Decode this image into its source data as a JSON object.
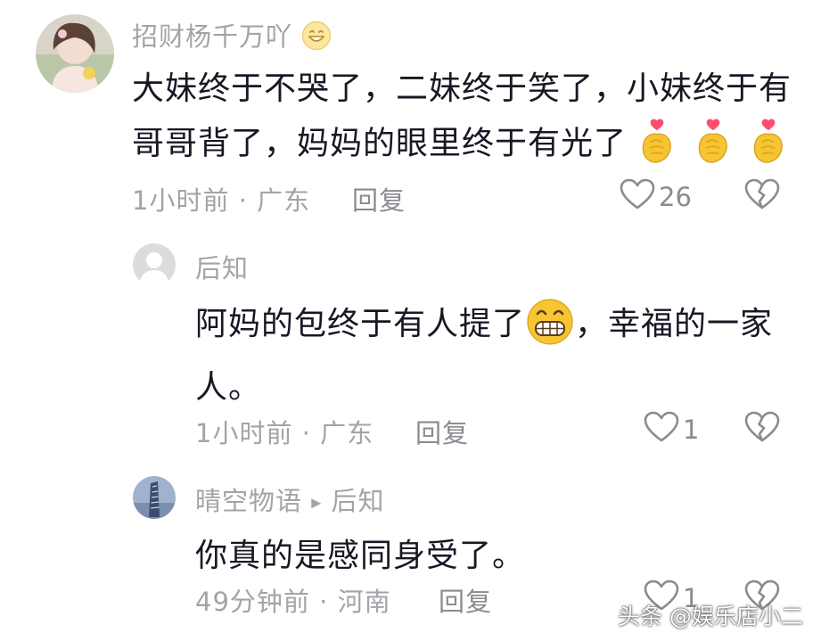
{
  "comments": [
    {
      "username": "招财杨千万吖",
      "line1": "大妹终于不哭了，二妹终于笑了，小妹终于有",
      "line2": "哥哥背了，妈妈的眼里终于有光了",
      "time": "1小时前",
      "dot": "·",
      "location": "广东",
      "reply": "回复",
      "likes": "26",
      "icons": [
        "smile-emoji",
        "finger-heart-emoji",
        "heart-outline-icon",
        "broken-heart-icon"
      ]
    },
    {
      "username": "后知",
      "line1": "阿妈的包终于有人提了",
      "line1b": "，幸福的一家",
      "line2": "人。",
      "time": "1小时前",
      "dot": "·",
      "location": "广东",
      "reply": "回复",
      "likes": "1",
      "icons": [
        "grin-emoji",
        "heart-outline-icon",
        "broken-heart-icon"
      ]
    },
    {
      "username": "晴空物语",
      "arrow": "▸",
      "reply_to": "后知",
      "line1": "你真的是感同身受了。",
      "time": "49分钟前",
      "dot": "·",
      "location": "河南",
      "reply": "回复",
      "likes": "1",
      "icons": [
        "play-arrow-icon",
        "heart-outline-icon",
        "broken-heart-icon"
      ]
    }
  ],
  "watermark": "头条 @娱乐店小二",
  "colors": {
    "text": "#161823",
    "meta": "#a3a3a8",
    "emoji_yellow": "#f7c531",
    "heart_pink": "#ff4d6d"
  }
}
